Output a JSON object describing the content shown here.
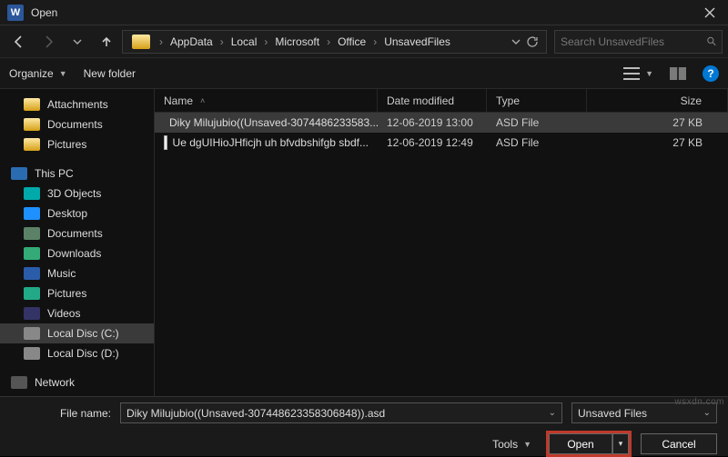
{
  "titlebar": {
    "title": "Open"
  },
  "nav": {
    "breadcrumb": [
      "AppData",
      "Local",
      "Microsoft",
      "Office",
      "UnsavedFiles"
    ],
    "search_placeholder": "Search UnsavedFiles"
  },
  "toolbar": {
    "organize": "Organize",
    "new_folder": "New folder",
    "help": "?"
  },
  "sidebar": {
    "quick": [
      {
        "label": "Attachments",
        "icon": "folder"
      },
      {
        "label": "Documents",
        "icon": "folder"
      },
      {
        "label": "Pictures",
        "icon": "folder"
      }
    ],
    "thispc_label": "This PC",
    "thispc": [
      {
        "label": "3D Objects",
        "icon": "3d"
      },
      {
        "label": "Desktop",
        "icon": "desktop"
      },
      {
        "label": "Documents",
        "icon": "docs"
      },
      {
        "label": "Downloads",
        "icon": "down"
      },
      {
        "label": "Music",
        "icon": "music"
      },
      {
        "label": "Pictures",
        "icon": "pics"
      },
      {
        "label": "Videos",
        "icon": "vids"
      },
      {
        "label": "Local Disc (C:)",
        "icon": "disc",
        "selected": true
      },
      {
        "label": "Local Disc (D:)",
        "icon": "disc"
      }
    ],
    "network_label": "Network"
  },
  "columns": {
    "name": "Name",
    "date": "Date modified",
    "type": "Type",
    "size": "Size"
  },
  "files": [
    {
      "name": "Diky Milujubio((Unsaved-307448623358306848)).asd",
      "display": "Diky Milujubio((Unsaved-3074486233583...",
      "date": "12-06-2019 13:00",
      "type": "ASD File",
      "size": "27 KB",
      "selected": true
    },
    {
      "name": "Ue dgUIHioJHficjh uh bfvdbshifgb sbdf...",
      "display": "Ue dgUIHioJHficjh uh bfvdbshifgb sbdf...",
      "date": "12-06-2019 12:49",
      "type": "ASD File",
      "size": "27 KB",
      "selected": false
    }
  ],
  "footer": {
    "filename_label": "File name:",
    "filename_value": "Diky Milujubio((Unsaved-307448623358306848)).asd",
    "filter_value": "Unsaved Files",
    "tools": "Tools",
    "open": "Open",
    "cancel": "Cancel"
  },
  "watermark": "wsxdn.com"
}
